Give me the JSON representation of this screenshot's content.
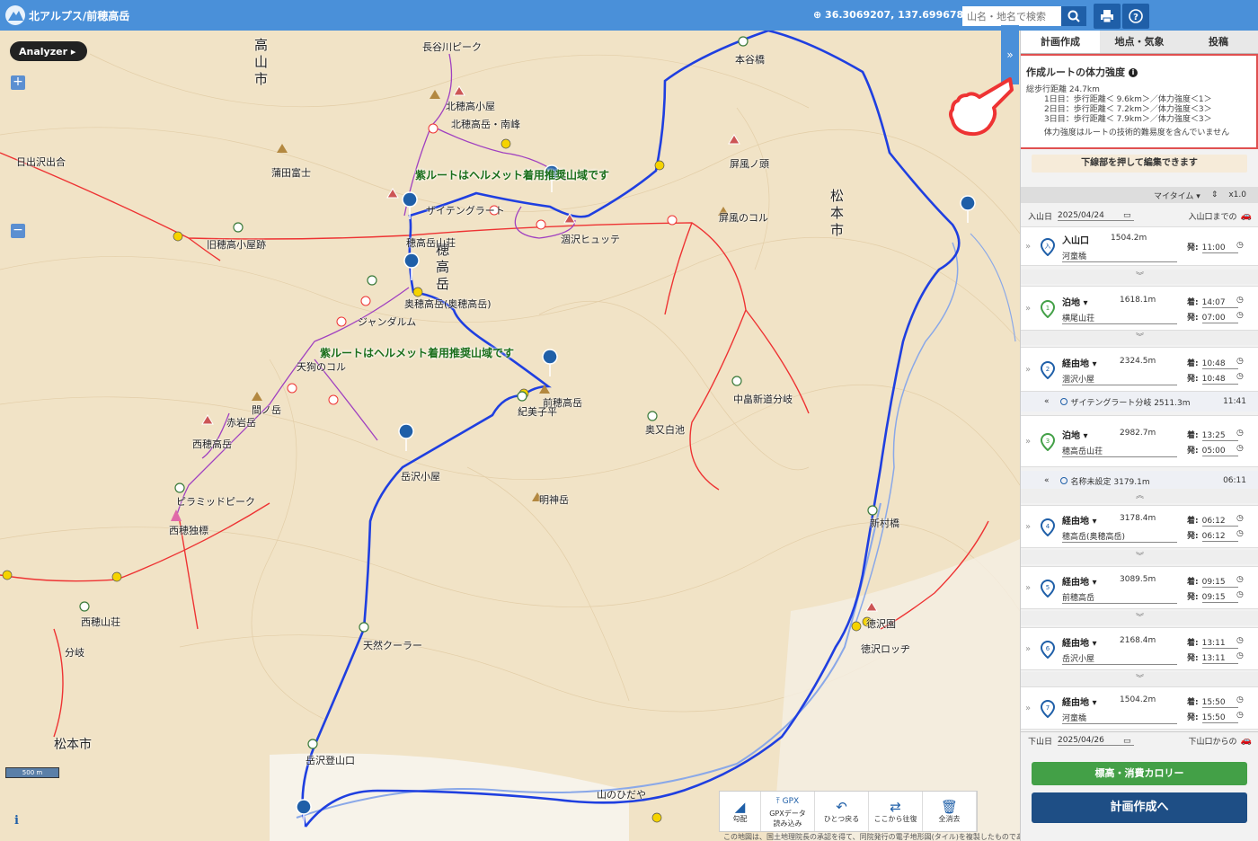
{
  "header": {
    "title": "北アルプス/前穂高岳",
    "coords": "36.3069207, 137.6996780",
    "search_placeholder": "山名・地名で検索"
  },
  "map": {
    "analyzer_label": "Analyzer ▸",
    "zoom_in": "+",
    "zoom_out": "−",
    "scale_label": "500 m",
    "info": "i",
    "attribution": "この地図は、国土地理院長の承認を得て、同院発行の電子地形図(タイル)を複製したものである。（承認番号　平27情複、第2014号）",
    "labels": [
      {
        "text": "高",
        "id": "l1"
      },
      {
        "text": "日出沢出合",
        "id": "l2"
      },
      {
        "text": "蒲田富士",
        "id": "l3"
      },
      {
        "text": "北穂高小屋",
        "id": "l4"
      },
      {
        "text": "北穂高岳・南峰",
        "id": "l5"
      },
      {
        "text": "長谷川ピーク",
        "id": "l6"
      },
      {
        "text": "奥又白池",
        "id": "l7"
      },
      {
        "text": "中畠新道分岐",
        "id": "l8"
      },
      {
        "text": "屏風ノ頭",
        "id": "l9"
      },
      {
        "text": "屏風のコル",
        "id": "l10"
      },
      {
        "text": "本谷橋",
        "id": "l11"
      },
      {
        "text": "涸沢ヒュッテ",
        "id": "l12"
      },
      {
        "text": "涸沢",
        "id": "l13"
      },
      {
        "text": "ザイテングラート",
        "id": "l14"
      },
      {
        "text": "穂高岳山荘",
        "id": "l15"
      },
      {
        "text": "奥穂高岳(奥穂高岳)",
        "id": "l16"
      },
      {
        "text": "ジャンダルム",
        "id": "l17"
      },
      {
        "text": "天狗のコル",
        "id": "l18"
      },
      {
        "text": "間ノ岳",
        "id": "l19"
      },
      {
        "text": "赤岩岳",
        "id": "l20"
      },
      {
        "text": "西穂高岳",
        "id": "l21"
      },
      {
        "text": "ピラミッドピーク",
        "id": "l22"
      },
      {
        "text": "西穂独標",
        "id": "l23"
      },
      {
        "text": "西穂山荘",
        "id": "l24"
      },
      {
        "text": "分岐",
        "id": "l25"
      },
      {
        "text": "前穂高岳",
        "id": "l26"
      },
      {
        "text": "紀美子平",
        "id": "l27"
      },
      {
        "text": "岳沢小屋",
        "id": "l28"
      },
      {
        "text": "明神岳",
        "id": "l29"
      },
      {
        "text": "天然クーラー",
        "id": "l30"
      },
      {
        "text": "岳沢登山口",
        "id": "l31"
      },
      {
        "text": "新村橋",
        "id": "l32"
      },
      {
        "text": "徳沢園",
        "id": "l33"
      },
      {
        "text": "徳沢ロッヂ",
        "id": "l34"
      },
      {
        "text": "横尾山荘",
        "id": "l35"
      },
      {
        "text": "山のひだや",
        "id": "l36"
      },
      {
        "text": "明神館",
        "id": "l37"
      },
      {
        "text": "旧穂高小屋跡",
        "id": "l38"
      }
    ],
    "big_labels": {
      "takayama": "高山市",
      "matsumoto_east": "松本市",
      "matsumoto_west": "松本市",
      "hotaka": "穂高岳"
    },
    "notes": [
      "紫ルートはヘルメット着用推奨山域です",
      "紫ルートはヘルメット着用推奨山域です"
    ],
    "toolbar": [
      {
        "icon": "◢",
        "label": "勾配"
      },
      {
        "icon": "⤒ GPX",
        "label": "GPXデータ\n読み込み"
      },
      {
        "icon": "↶",
        "label": "ひとつ戻る"
      },
      {
        "icon": "⇄",
        "label": "ここから往復"
      },
      {
        "icon": "🗑",
        "label": "全消去"
      }
    ]
  },
  "panel": {
    "toggle": "»",
    "tabs": [
      "計画作成",
      "地点・気象",
      "投稿"
    ],
    "strength": {
      "title": "作成ルートの体力強度",
      "total": "総歩行距離 24.7km",
      "days": [
        "1日目：歩行距離＜ 9.6km＞／体力強度＜1＞",
        "2日目：歩行距離＜ 7.2km＞／体力強度＜3＞",
        "3日目：歩行距離＜ 7.9km＞／体力強度＜3＞"
      ],
      "note": "体力強度はルートの技術的難易度を含んでいません"
    },
    "edit_hint": "下線部を押して編集できます",
    "time_mode": "マイタイム ▾",
    "multiplier": "x1.0",
    "start": {
      "label": "入山日",
      "date": "2025/04/24",
      "access": "入山口までの"
    },
    "end": {
      "label": "下山日",
      "date": "2025/04/26",
      "access": "下山口からの"
    },
    "waypoints": [
      {
        "type": "入山口",
        "alt": "1504.2m",
        "name": "河童橋",
        "times": [
          [
            "発:",
            "11:00"
          ]
        ],
        "color": "#1f5fa8",
        "num": "入"
      },
      {
        "type": "泊地 ▾",
        "alt": "1618.1m",
        "name": "横尾山荘",
        "times": [
          [
            "着:",
            "14:07"
          ],
          [
            "発:",
            "07:00"
          ]
        ],
        "color": "#43a047",
        "num": "1"
      },
      {
        "type": "経由地 ▾",
        "alt": "2324.5m",
        "name": "涸沢小屋",
        "times": [
          [
            "着:",
            "10:48"
          ],
          [
            "発:",
            "10:48"
          ]
        ],
        "color": "#1f5fa8",
        "num": "2"
      },
      {
        "type": "泊地 ▾",
        "alt": "2982.7m",
        "name": "穂高岳山荘",
        "times": [
          [
            "着:",
            "13:25"
          ],
          [
            "発:",
            "05:00"
          ]
        ],
        "color": "#43a047",
        "num": "3"
      },
      {
        "type": "経由地 ▾",
        "alt": "3178.4m",
        "name": "穂高岳(奥穂高岳)",
        "times": [
          [
            "着:",
            "06:12"
          ],
          [
            "発:",
            "06:12"
          ]
        ],
        "color": "#1f5fa8",
        "num": "4"
      },
      {
        "type": "経由地 ▾",
        "alt": "3089.5m",
        "name": "前穂高岳",
        "times": [
          [
            "着:",
            "09:15"
          ],
          [
            "発:",
            "09:15"
          ]
        ],
        "color": "#1f5fa8",
        "num": "5"
      },
      {
        "type": "経由地 ▾",
        "alt": "2168.4m",
        "name": "岳沢小屋",
        "times": [
          [
            "着:",
            "13:11"
          ],
          [
            "発:",
            "13:11"
          ]
        ],
        "color": "#1f5fa8",
        "num": "6"
      },
      {
        "type": "経由地 ▾",
        "alt": "1504.2m",
        "name": "河童橋",
        "times": [
          [
            "着:",
            "15:50"
          ],
          [
            "発:",
            "15:50"
          ]
        ],
        "color": "#1f5fa8",
        "num": "7"
      }
    ],
    "sub_points": [
      {
        "name": "ザイテングラート分岐 2511.3m",
        "time": "11:41"
      },
      {
        "name": "名称未設定 3179.1m",
        "time": "06:11"
      }
    ],
    "elevation_button": "標高・消費カロリー",
    "plan_button": "計画作成へ"
  }
}
